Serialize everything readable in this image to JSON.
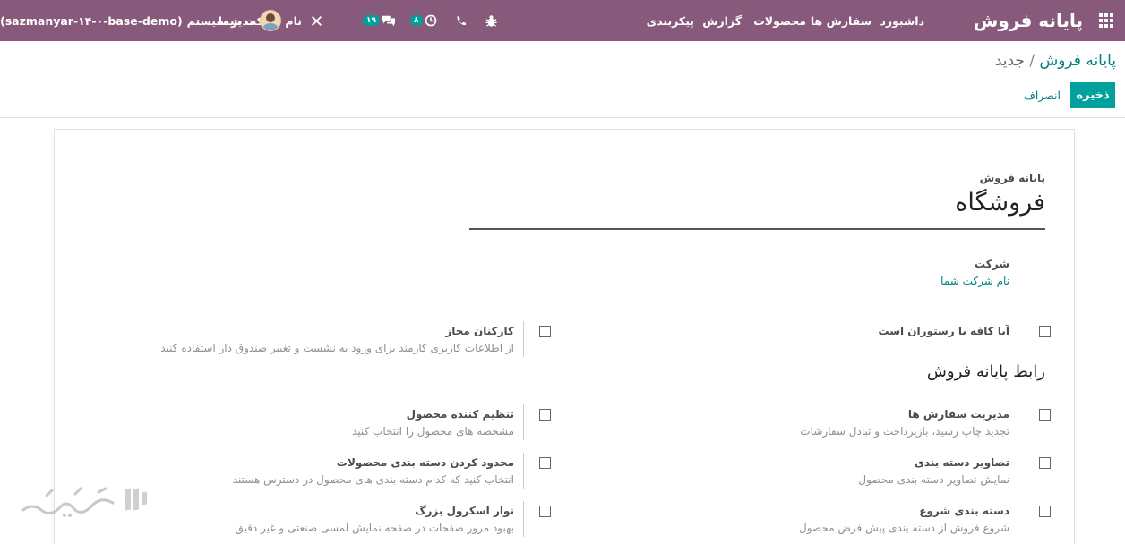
{
  "navbar": {
    "brand": "پایانه فروش",
    "menu": [
      "داشبورد",
      "سفارش ها",
      "محصولات",
      "گزارش",
      "پیکربندی"
    ],
    "company": "نام شرکت شما",
    "messages_count": "۱۹",
    "activities_count": "۸",
    "user_name": "مدیر سیستم",
    "database": "(sazmanyar-۱۴-۰-base-demo)"
  },
  "breadcrumb": {
    "parent": "پایانه فروش",
    "separator": "/",
    "current": "جدید"
  },
  "buttons": {
    "save": "ذخیره",
    "discard": "انصراف"
  },
  "form": {
    "name_label": "پایانه فروش",
    "name_value": "فروشگاه",
    "company_label": "شرکت",
    "company_value": "نام شرکت شما",
    "section_title": "رابط پایانه فروش",
    "settings": [
      {
        "title": "آیا کافه یا رستوران است",
        "description": ""
      },
      {
        "title": "کارکنان مجاز",
        "description": "از اطلاعات کاربری کارمند برای ورود به نشست و تغییر صندوق دار استفاده کنید"
      },
      {
        "title": "مدیریت سفارش ها",
        "description": "تجدید چاپ رسید، بازپرداخت و تبادل سفارشات"
      },
      {
        "title": "تنظیم کننده محصول",
        "description": "مشخصه های محصول را انتخاب کنید"
      },
      {
        "title": "تصاویر دسته بندی",
        "description": "نمایش تصاویر دسته بندی محصول"
      },
      {
        "title": "محدود کردن دسته بندی محصولات",
        "description": "انتخاب کنید که کدام دسته بندی های محصول در دسترس هستند"
      },
      {
        "title": "دسته بندی شروع",
        "description": "شروع فروش از دسته بندی پیش فرض محصول"
      },
      {
        "title": "نوار اسکرول بزرگ",
        "description": "بهبود مرور صفحات در صفحه نمایش لمسی صنعتی و غیر دقیق"
      }
    ]
  },
  "watermark": {
    "text": "تست‌گیر"
  },
  "colors": {
    "navbar": "#875a7b",
    "accent": "#00a09d",
    "link": "#017e84"
  }
}
